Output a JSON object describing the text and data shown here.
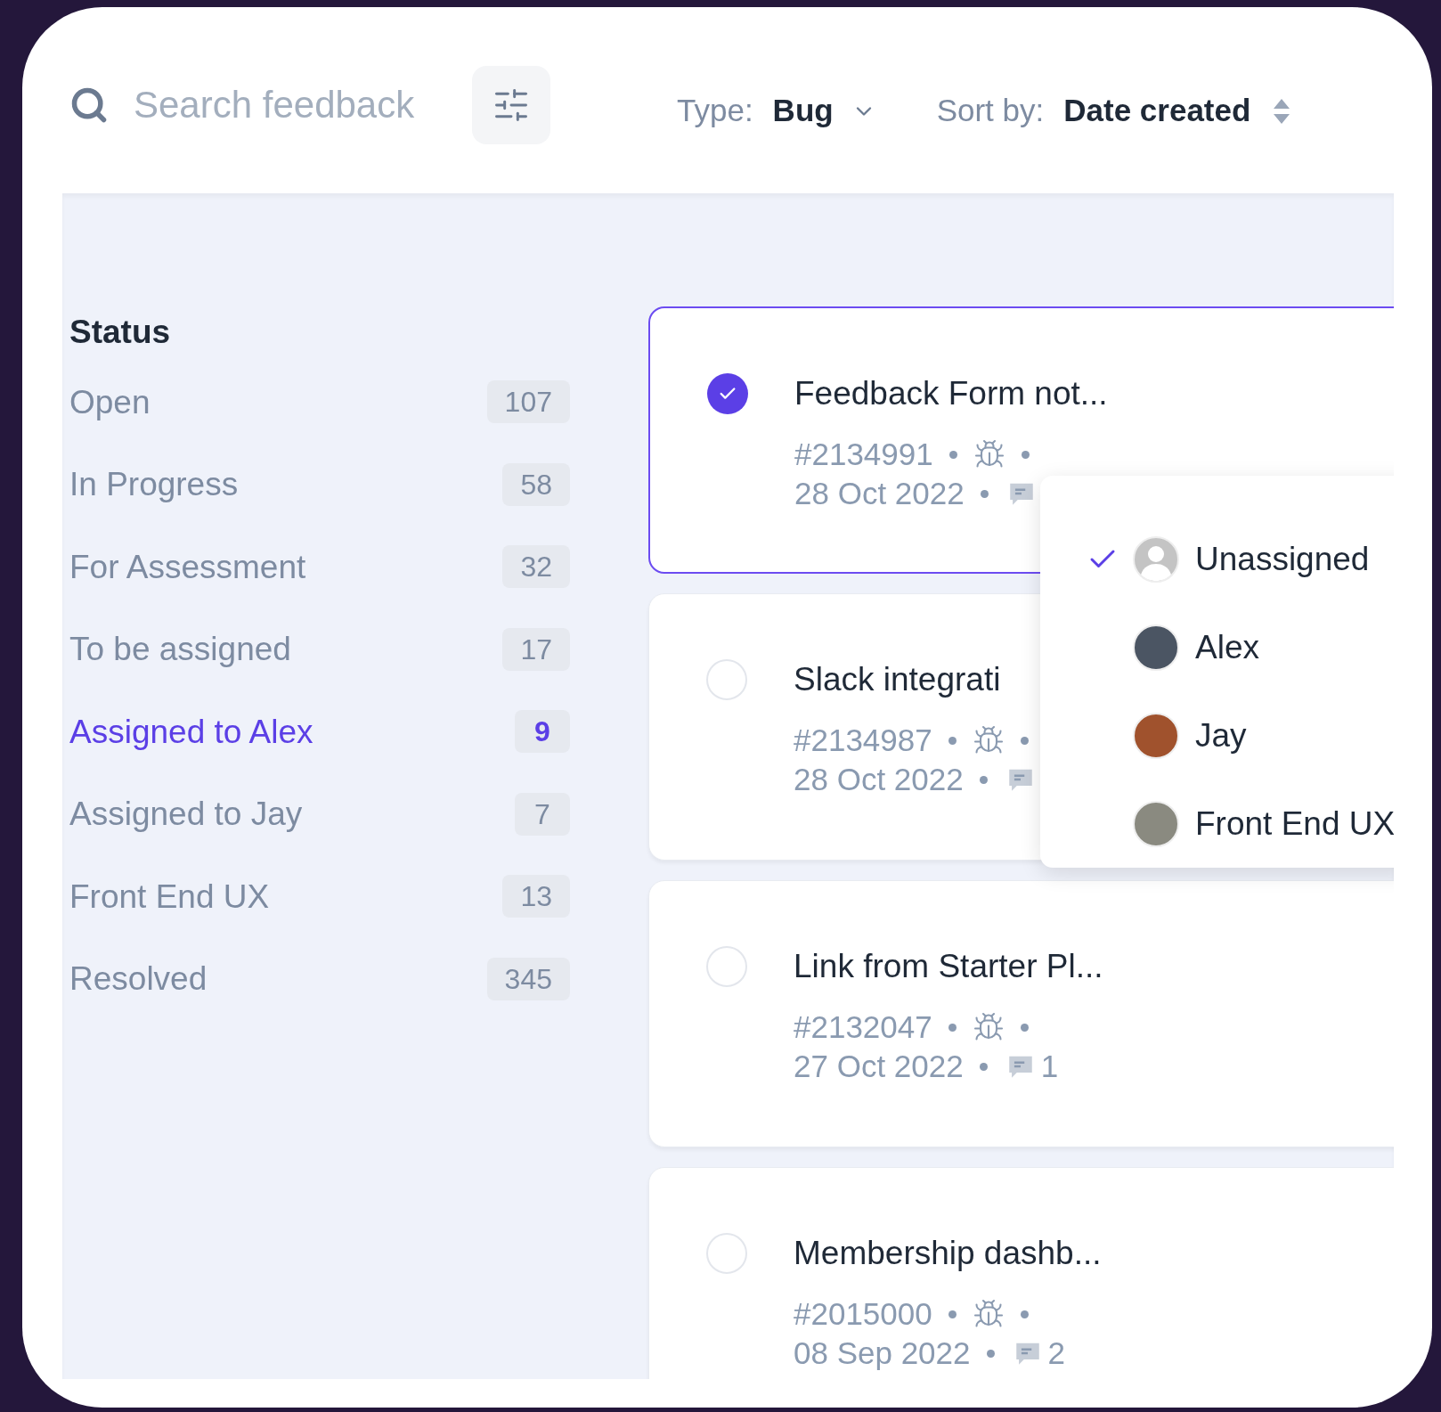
{
  "search": {
    "placeholder": "Search feedback"
  },
  "filters": [
    {
      "kind": "dropdown",
      "label": "Type:",
      "value": "Bug"
    },
    {
      "kind": "sort",
      "label": "Sort by:",
      "value": "Date created"
    }
  ],
  "sidebar": {
    "heading": "Status",
    "items": [
      {
        "label": "Open",
        "count": "107",
        "selected": false
      },
      {
        "label": "In Progress",
        "count": "58",
        "selected": false
      },
      {
        "label": "For Assessment",
        "count": "32",
        "selected": false
      },
      {
        "label": "To be assigned",
        "count": "17",
        "selected": false
      },
      {
        "label": "Assigned to Alex",
        "count": "9",
        "selected": true
      },
      {
        "label": "Assigned to Jay",
        "count": "7",
        "selected": false
      },
      {
        "label": "Front End UX",
        "count": "13",
        "selected": false
      },
      {
        "label": "Resolved",
        "count": "345",
        "selected": false
      }
    ]
  },
  "feedback_items": [
    {
      "title": "Feedback Form not...",
      "id": "#2134991",
      "date": "28 Oct 2022",
      "selected": true
    },
    {
      "title": "Slack integrati",
      "id": "#2134987",
      "date": "28 Oct 2022",
      "selected": false
    },
    {
      "title": "Link from Starter Pl...",
      "id": "#2132047",
      "date": "27 Oct 2022",
      "comments": "1",
      "selected": false
    },
    {
      "title": "Membership dashb...",
      "id": "#2015000",
      "date": "08 Sep 2022",
      "comments": "2",
      "selected": false
    }
  ],
  "assignee_menu": {
    "items": [
      {
        "kind": "none",
        "name": "Unassigned",
        "selected": true
      },
      {
        "kind": "person",
        "name": "Alex",
        "selected": false
      },
      {
        "kind": "person",
        "name": "Jay",
        "selected": false
      },
      {
        "kind": "person",
        "name": "Front End UX",
        "selected": false
      }
    ]
  }
}
